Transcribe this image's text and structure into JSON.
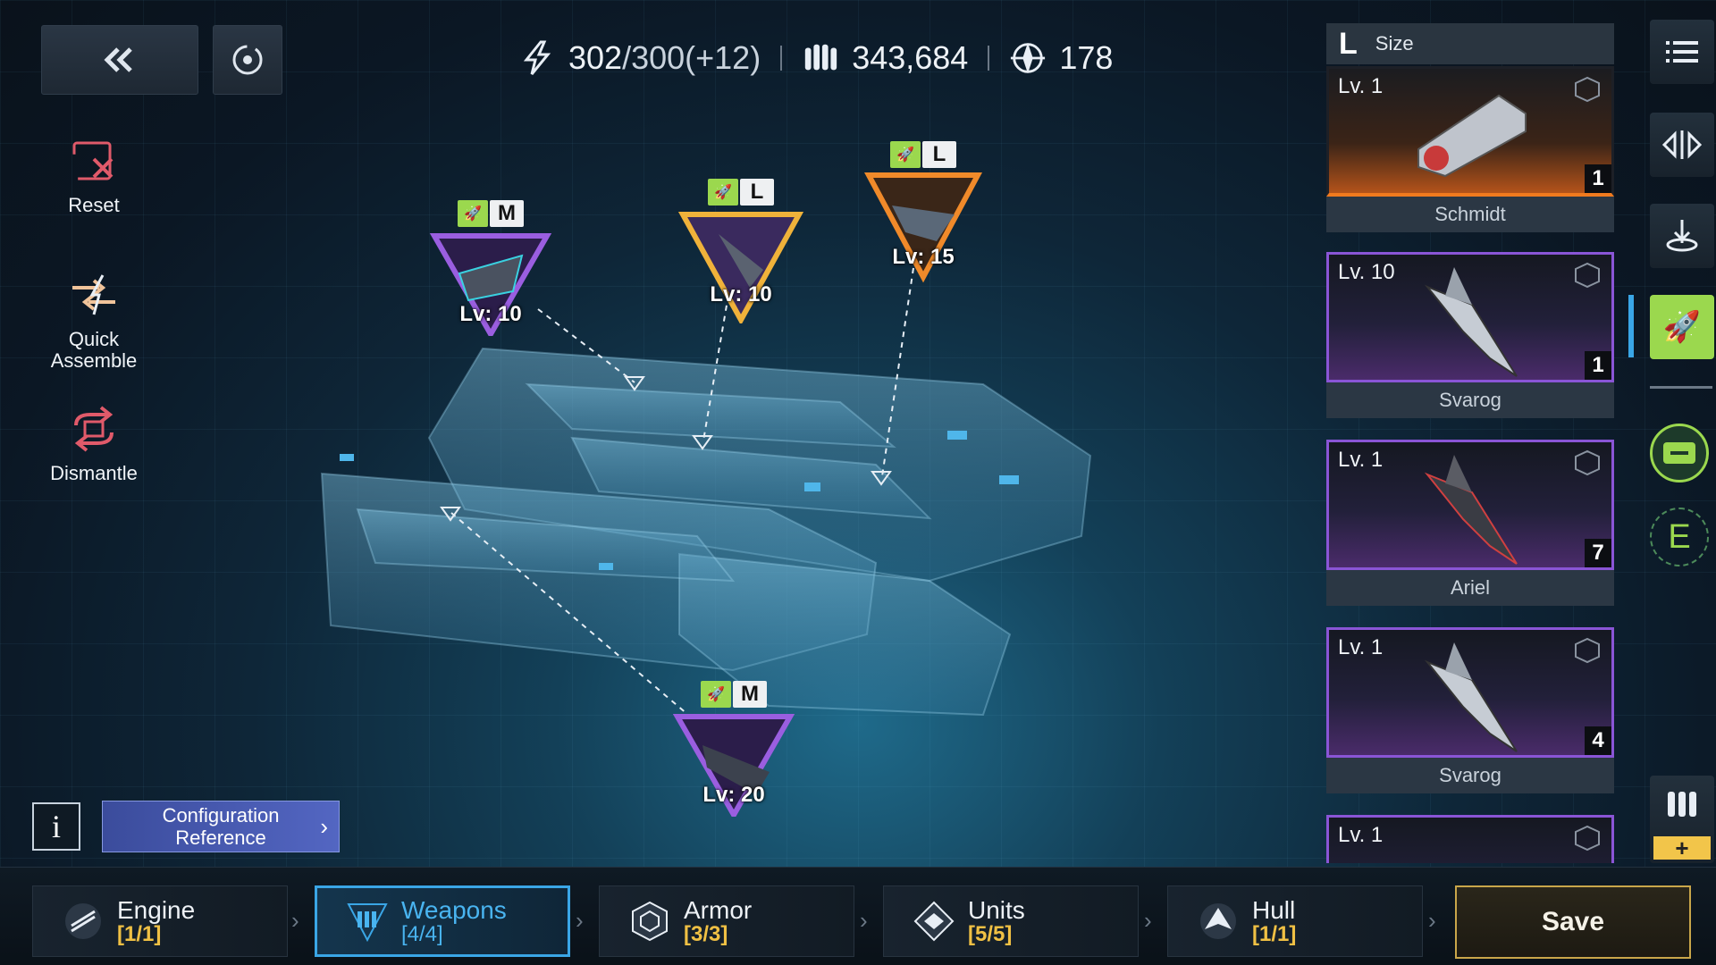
{
  "resources": {
    "energy_current": "302",
    "energy_max": "/300(+12)",
    "firepower": "343,684",
    "command": "178"
  },
  "tools": {
    "reset": "Reset",
    "quick_assemble": "Quick\nAssemble",
    "dismantle": "Dismantle"
  },
  "slots": [
    {
      "size": "M",
      "level": "Lv: 10",
      "frame": "purple"
    },
    {
      "size": "L",
      "level": "Lv: 10",
      "frame": "gold"
    },
    {
      "size": "L",
      "level": "Lv: 15",
      "frame": "orange"
    },
    {
      "size": "M",
      "level": "Lv: 20",
      "frame": "purple"
    }
  ],
  "info_label": "i",
  "config_reference": "Configuration\nReference",
  "tabs": [
    {
      "name": "Engine",
      "count": "[1/1]",
      "icon": "engine-icon"
    },
    {
      "name": "Weapons",
      "count": "[4/4]",
      "icon": "weapons-icon"
    },
    {
      "name": "Armor",
      "count": "[3/3]",
      "icon": "armor-icon"
    },
    {
      "name": "Units",
      "count": "[5/5]",
      "icon": "units-icon"
    },
    {
      "name": "Hull",
      "count": "[1/1]",
      "icon": "hull-icon"
    }
  ],
  "save_label": "Save",
  "panel": {
    "size_letter": "L",
    "size_label": "Size",
    "items": [
      {
        "level": "Lv. 1",
        "name": "Schmidt",
        "count": "1",
        "rarity": "orange"
      },
      {
        "level": "Lv. 10",
        "name": "Svarog",
        "count": "1",
        "rarity": "purple"
      },
      {
        "level": "Lv. 1",
        "name": "Ariel",
        "count": "7",
        "rarity": "purple"
      },
      {
        "level": "Lv. 1",
        "name": "Svarog",
        "count": "4",
        "rarity": "purple"
      },
      {
        "level": "Lv. 1",
        "name": "",
        "count": "",
        "rarity": "purple"
      }
    ]
  },
  "sidebar": {
    "items": [
      "list-icon",
      "direction-icon",
      "anchor-icon",
      "missile-icon",
      "storage-icon",
      "e-icon"
    ],
    "e_letter": "E",
    "ammo_plus": "+"
  },
  "colors": {
    "accent_blue": "#3aa6e6",
    "count_yellow": "#f0c044",
    "slot_green": "#9bd84e",
    "rarity_purple": "#8a55d6",
    "rarity_orange": "#f07a1e",
    "save_border": "#c9a64a"
  }
}
